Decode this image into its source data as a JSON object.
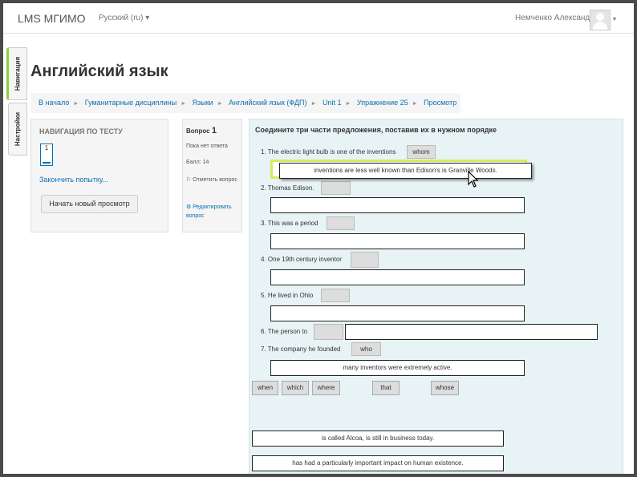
{
  "topbar": {
    "brand": "LMS МГИМО",
    "language": "Русский (ru)",
    "lang_caret": "▾",
    "user_name": "Немченко Александр",
    "user_caret": "▾"
  },
  "sidetabs": {
    "navigation": "Навигация",
    "settings": "Настройки"
  },
  "page_title": "Английский язык",
  "breadcrumb": [
    "В начало",
    "Гуманитарные дисциплины",
    "Языки",
    "Английский язык (ФДП)",
    "Unit 1",
    "Упражнение 25",
    "Просмотр"
  ],
  "quiz_nav": {
    "title": "НАВИГАЦИЯ ПО ТЕСТУ",
    "question_number": "1",
    "finish_link": "Закончить попытку...",
    "new_preview_button": "Начать новый просмотр"
  },
  "question_info": {
    "label": "Вопрос",
    "number": "1",
    "state": "Пока нет ответа",
    "mark": "Балл: 14",
    "flag": "Отметить вопрос",
    "edit": "Редактировать вопрос"
  },
  "question": {
    "text": "Соедините три части предложения, поставив их в нужном порядке",
    "items": [
      {
        "num": "1.",
        "text": "The electric light bulb is one of the inventions",
        "slot": "whom",
        "box": ""
      },
      {
        "num": "2.",
        "text": "Thomas Edison.",
        "slot": "",
        "box": ""
      },
      {
        "num": "3.",
        "text": "This was a period",
        "slot": "",
        "box": ""
      },
      {
        "num": "4.",
        "text": "One 19th century inventor",
        "slot": "",
        "box": ""
      },
      {
        "num": "5.",
        "text": "He lived in Ohio",
        "slot": "",
        "box": ""
      },
      {
        "num": "6.",
        "text": "The person to",
        "slot": "",
        "box": ""
      },
      {
        "num": "7.",
        "text": "The company he founded",
        "slot": "who",
        "box": "many inventors were extremely active."
      }
    ],
    "dragging_phrase": "inventions are less well known than Edison's is Granville Woods.",
    "choices": [
      "when",
      "which",
      "where",
      "that",
      "whose"
    ],
    "phrases": [
      "is called Alcoa, is still in business today.",
      "has had a particularly important impact on human existence."
    ]
  },
  "colors": {
    "accent_green": "#8fce3a",
    "link_blue": "#0a6fb1",
    "highlight_yellow": "#d6ec5e"
  }
}
